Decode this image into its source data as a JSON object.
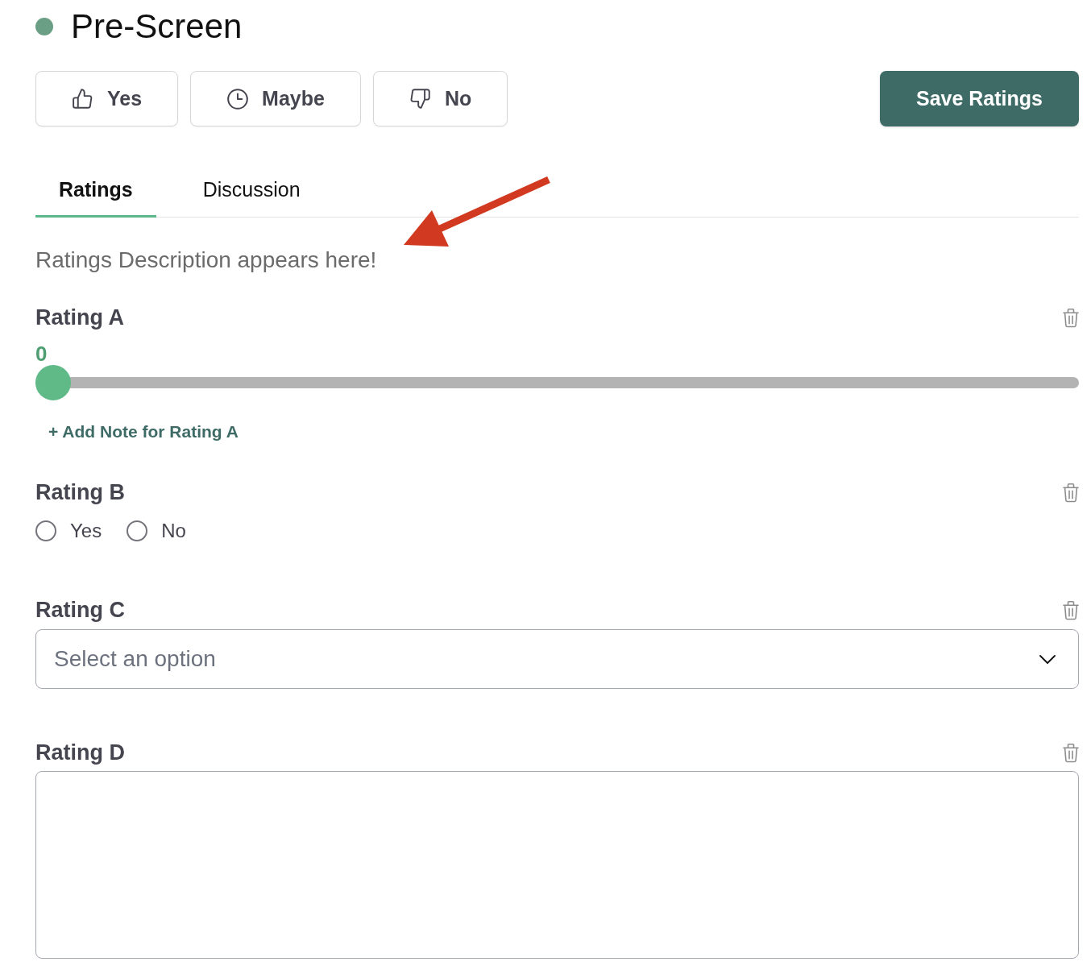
{
  "header": {
    "title": "Pre-Screen"
  },
  "decision_buttons": [
    {
      "kind": "yes",
      "label": "Yes"
    },
    {
      "kind": "maybe",
      "label": "Maybe"
    },
    {
      "kind": "no",
      "label": "No"
    }
  ],
  "save_button": {
    "label": "Save Ratings"
  },
  "tabs": [
    {
      "label": "Ratings",
      "selected": true
    },
    {
      "label": "Discussion",
      "selected": false
    }
  ],
  "description": "Ratings Description appears here!",
  "ratings": [
    {
      "kind": "slider",
      "label": "Rating A",
      "reading": "0",
      "level": 0,
      "add_note": "+ Add Note for Rating A"
    },
    {
      "kind": "radio",
      "label": "Rating B",
      "options": [
        {
          "label": "Yes",
          "selected": false
        },
        {
          "label": "No",
          "selected": false
        }
      ]
    },
    {
      "kind": "select",
      "label": "Rating C",
      "placeholder": "Select an option"
    },
    {
      "kind": "textarea",
      "label": "Rating D"
    }
  ]
}
